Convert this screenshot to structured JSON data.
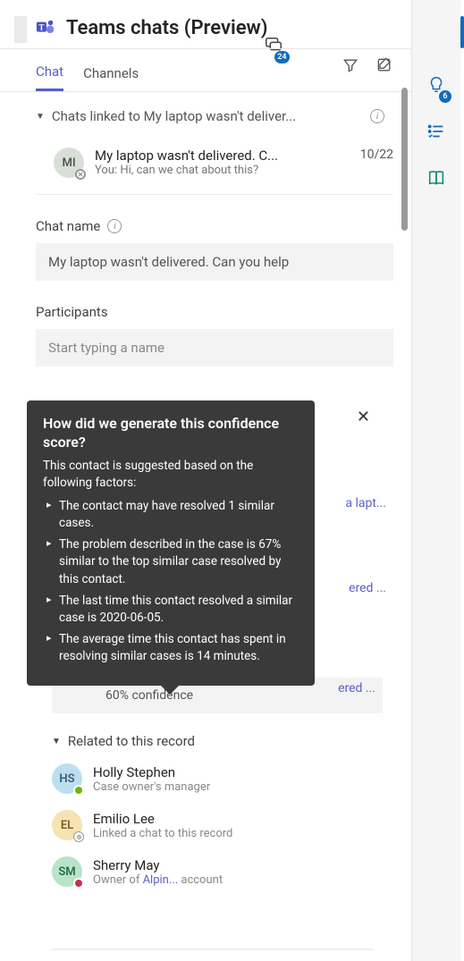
{
  "header": {
    "title": "Teams chats (Preview)",
    "chat_badge": "24"
  },
  "tabs": {
    "chat": "Chat",
    "channels": "Channels"
  },
  "linked_section": {
    "label": "Chats linked to My laptop wasn't deliver..."
  },
  "chat_item": {
    "avatar_initials": "MI",
    "title": "My laptop wasn't delivered. C...",
    "date": "10/22",
    "preview": "You: Hi, can we chat about this?"
  },
  "form": {
    "chat_name_label": "Chat name",
    "chat_name_value": "My laptop wasn't delivered. Can you help",
    "participants_label": "Participants",
    "participants_placeholder": "Start typing a name"
  },
  "tooltip": {
    "title": "How did we generate this confidence score?",
    "subtitle": "This contact is suggested based on the following factors:",
    "bullets": [
      "The contact may have resolved 1 similar cases.",
      "The problem described in the case is 67% similar to the top similar case resolved by this contact.",
      "The last time this contact resolved a similar case is 2020-06-05.",
      "The average time this contact has spent in resolving similar cases is 14 minutes."
    ]
  },
  "peek": {
    "one": "a lapt...",
    "two": "ered ...",
    "three": "ered ..."
  },
  "confidence": {
    "label": "60% confidence"
  },
  "related": {
    "header": "Related to this record",
    "people": [
      {
        "initials": "HS",
        "bg": "#bcdff0",
        "name": "Holly Stephen",
        "sub": "Case owner's manager",
        "presence": "#6bb700"
      },
      {
        "initials": "EL",
        "bg": "#f5e3b3",
        "name": "Emilio Lee",
        "sub": "Linked a chat to this record",
        "presence": "#ffffff"
      },
      {
        "initials": "SM",
        "bg": "#b8e4ca",
        "name": "Sherry May",
        "sub_prefix": "Owner of ",
        "sub_link": "Alpin...",
        "sub_suffix": " account",
        "presence": "#c4314b"
      }
    ]
  },
  "side_rail": {
    "idea_badge": "6"
  }
}
